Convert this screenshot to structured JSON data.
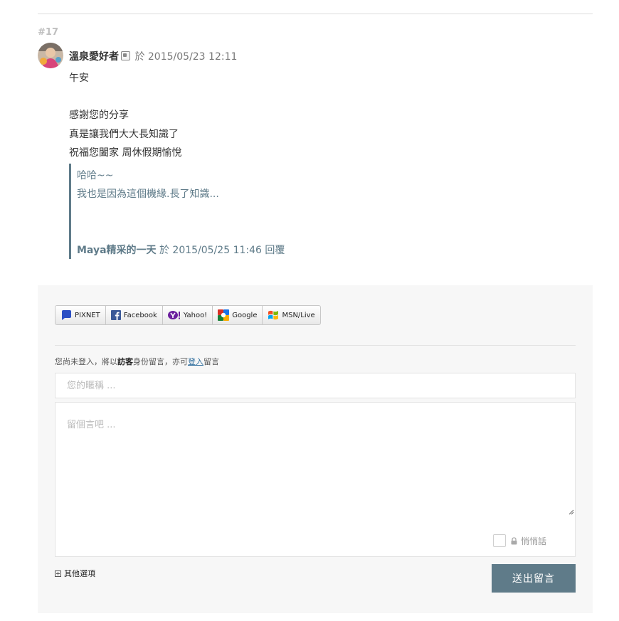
{
  "comment": {
    "number": "#17",
    "author": "溫泉愛好者",
    "meta": "於 2015/05/23 12:11",
    "body": [
      "午安",
      "感謝您的分享",
      "真是讓我們大大長知識了",
      "祝福您闔家 周休假期愉悅"
    ],
    "reply": {
      "lines": [
        "哈哈~~",
        "我也是因為這個機緣.長了知識..."
      ],
      "author": "Maya精采的一天",
      "meta": "於 2015/05/25 11:46 回覆"
    }
  },
  "form": {
    "login_buttons": [
      {
        "label": "PIXNET",
        "icon": "pixnet-icon"
      },
      {
        "label": "Facebook",
        "icon": "facebook-icon"
      },
      {
        "label": "Yahoo!",
        "icon": "yahoo-icon"
      },
      {
        "label": "Google",
        "icon": "google-icon"
      },
      {
        "label": "MSN/Live",
        "icon": "msn-icon"
      }
    ],
    "notice_prefix": "您尚未登入，將以",
    "notice_guest": "訪客",
    "notice_middle": "身份留言，亦可",
    "notice_login": "登入",
    "notice_suffix": "留言",
    "name_placeholder": "您的暱稱 ...",
    "message_placeholder": "留個言吧 ...",
    "private_label": "悄悄話",
    "more_options": "其他選項",
    "submit_label": "送出留言"
  },
  "colors": {
    "accent": "#5f7b89",
    "panel_bg": "#f7f7f7",
    "link": "#2a6a9b"
  }
}
